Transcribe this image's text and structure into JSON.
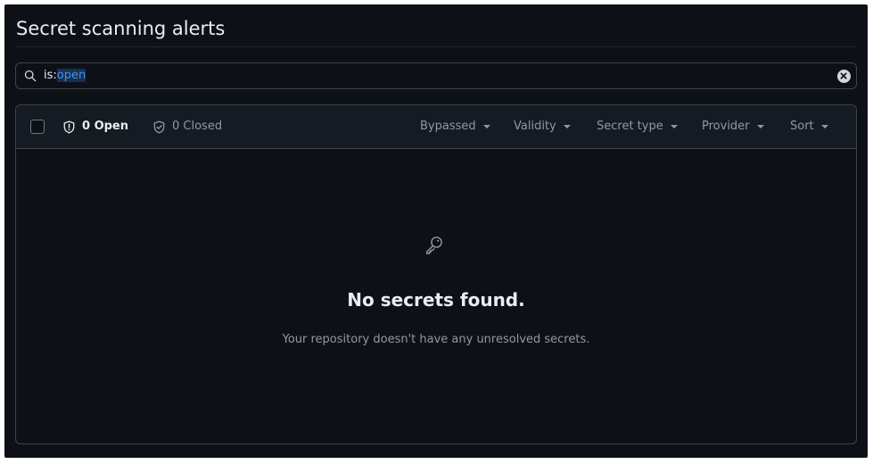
{
  "page": {
    "title": "Secret scanning alerts"
  },
  "search": {
    "query_key": "is:",
    "query_value": "open",
    "clear_icon": "x-circle-fill-icon"
  },
  "states": {
    "open_label": "0 Open",
    "open_icon": "shield-icon",
    "closed_label": "0 Closed",
    "closed_icon": "shield-check-icon"
  },
  "filters": [
    {
      "label": "Bypassed"
    },
    {
      "label": "Validity"
    },
    {
      "label": "Secret type"
    },
    {
      "label": "Provider"
    },
    {
      "label": "Sort"
    }
  ],
  "empty_state": {
    "icon": "key-icon",
    "heading": "No secrets found.",
    "description": "Your repository doesn't have any unresolved secrets."
  },
  "colors": {
    "background": "#0d1117",
    "header_background": "#151b23",
    "border": "#3d444d",
    "text_primary": "#e6edf3",
    "text_muted": "#9198a1",
    "accent_blue": "#4493f8"
  }
}
